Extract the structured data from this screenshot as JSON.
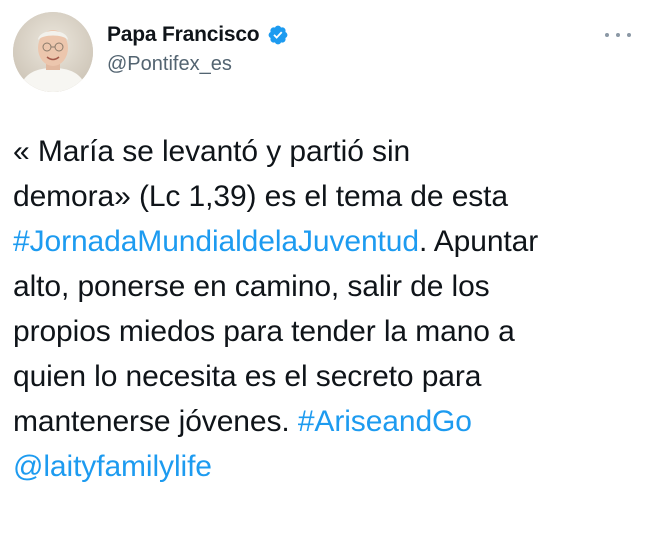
{
  "author": {
    "display_name": "Papa Francisco",
    "handle": "@Pontifex_es",
    "verified": true,
    "avatar_icon": "profile-photo",
    "verified_icon": "verified-badge-icon",
    "more_icon": "more-options-icon"
  },
  "tweet": {
    "lines": [
      [
        {
          "text": "« María se levantó y partió sin",
          "type": "text"
        }
      ],
      [
        {
          "text": "demora» (Lc 1,39) es el tema de esta",
          "type": "text"
        }
      ],
      [
        {
          "text": "#JornadaMundialdelaJuventud",
          "type": "hashtag"
        },
        {
          "text": ". Apuntar",
          "type": "text"
        }
      ],
      [
        {
          "text": "alto, ponerse en camino, salir de los",
          "type": "text"
        }
      ],
      [
        {
          "text": "propios miedos para tender la mano a",
          "type": "text"
        }
      ],
      [
        {
          "text": "quien lo necesita es el secreto para",
          "type": "text"
        }
      ],
      [
        {
          "text": "mantenerse jóvenes. ",
          "type": "text"
        },
        {
          "text": "#AriseandGo",
          "type": "hashtag"
        }
      ],
      [
        {
          "text": "@laityfamilylife",
          "type": "mention"
        }
      ]
    ]
  },
  "colors": {
    "link": "#1d9bf0",
    "text": "#0f1419",
    "secondary": "#536471",
    "verified": "#1d9bf0"
  }
}
